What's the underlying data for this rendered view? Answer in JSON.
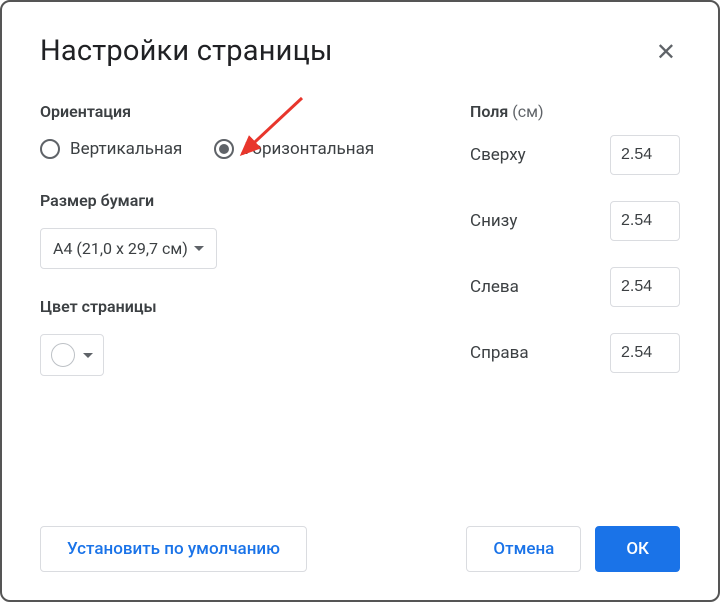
{
  "dialog": {
    "title": "Настройки страницы"
  },
  "orientation": {
    "label": "Ориентация",
    "portrait": "Вертикальная",
    "landscape": "Горизонтальная",
    "selected": "landscape"
  },
  "paper_size": {
    "label": "Размер бумаги",
    "value": "A4 (21,0 x 29,7 см)"
  },
  "page_color": {
    "label": "Цвет страницы",
    "value": "#ffffff"
  },
  "margins": {
    "label": "Поля",
    "unit": "(см)",
    "top": {
      "label": "Сверху",
      "value": "2.54"
    },
    "bottom": {
      "label": "Снизу",
      "value": "2.54"
    },
    "left": {
      "label": "Слева",
      "value": "2.54"
    },
    "right": {
      "label": "Справа",
      "value": "2.54"
    }
  },
  "buttons": {
    "set_default": "Установить по умолчанию",
    "cancel": "Отмена",
    "ok": "ОК"
  }
}
